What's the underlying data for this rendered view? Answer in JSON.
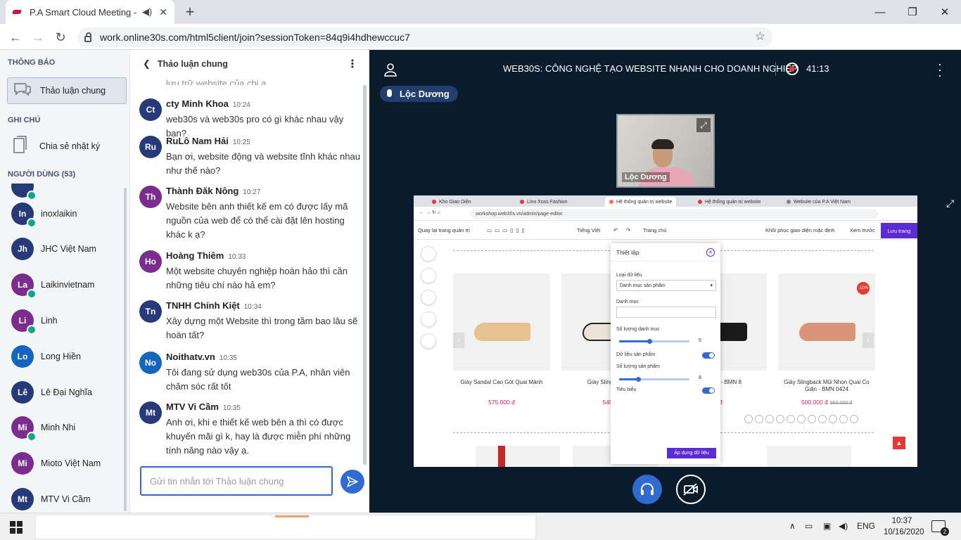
{
  "browser": {
    "tab_title": "P.A Smart Cloud Meeting - V",
    "url": "work.online30s.com/html5client/join?sessionToken=84q9i4hdhewccuc7"
  },
  "left_panel": {
    "notifications_heading": "THÔNG BÁO",
    "public_chat_label": "Thảo luận chung",
    "notes_heading": "GHI CHÚ",
    "shared_notes_label": "Chia sẻ nhật ký",
    "users_heading": "NGƯỜI DÙNG (53)",
    "users": [
      {
        "initials": "In",
        "name": "inoxlaikin"
      },
      {
        "initials": "Jh",
        "name": "JHC Việt Nam"
      },
      {
        "initials": "La",
        "name": "Laikinvietnam"
      },
      {
        "initials": "Li",
        "name": "Linh"
      },
      {
        "initials": "Lo",
        "name": "Long Hiền"
      },
      {
        "initials": "Lê",
        "name": "Lê Đại Nghĩa"
      },
      {
        "initials": "Mi",
        "name": "Minh Nhi"
      },
      {
        "initials": "Mi",
        "name": "Mioto Việt Nam"
      },
      {
        "initials": "Mt",
        "name": "MTV Vi Cầm"
      }
    ]
  },
  "chat": {
    "title": "Thảo luận chung",
    "top_fragment": "lưu trữ website của chị ạ",
    "messages": [
      {
        "initials": "Ct",
        "name": "cty Minh Khoa",
        "time": "10:24",
        "text": "web30s và web30s pro có gì khác nhau vậy bạn?"
      },
      {
        "initials": "Ru",
        "name": "RuLô Nam Hải",
        "time": "10:25",
        "text": "Bạn ơi, website động và website tĩnh khác nhau như thế nào?"
      },
      {
        "initials": "Th",
        "name": "Thành Đăk Nông",
        "time": "10:27",
        "text": "Website bên anh thiết kế em có được lấy mã nguồn của web để có thể cài đặt lên hosting khác k ạ?"
      },
      {
        "initials": "Ho",
        "name": "Hoàng Thiêm",
        "time": "10:33",
        "text": "Một website chuyên nghiệp hoàn hảo thì cần những tiêu chí nào hả em?"
      },
      {
        "initials": "Tn",
        "name": "TNHH Chính Kiệt",
        "time": "10:34",
        "text": "Xây dựng một Website thì trong tầm bao lâu sẽ hoàn tất?"
      },
      {
        "initials": "No",
        "name": "Noithatv.vn",
        "time": "10:35",
        "text": "Tôi đang sử dụng web30s của P.A, nhân viên chăm sóc rất tốt"
      },
      {
        "initials": "Mt",
        "name": "MTV Vi Cầm",
        "time": "10:35",
        "text": "Anh ơi, khi e thiết kế web bên a thì có được khuyến mãi gì k, hay là được miễn phí những tính năng nào vậy ạ."
      }
    ],
    "input_placeholder": "Gửi tin nhắn tới Thảo luận chung"
  },
  "meeting": {
    "title": "WEB30S: CÔNG NGHỆ TẠO WEBSITE NHANH CHO DOANH NGHIỆP",
    "recording_time": "41:13",
    "talker": "Lộc Dương",
    "webcam_name": "Lộc Dương"
  },
  "shared_screen": {
    "tabs": [
      "Kho Giao Diện",
      "Lino Xoss Fashion",
      "Hệ thống quản trị website",
      "Hệ thống quản trị website",
      "Website của P.A Việt Nam"
    ],
    "url": "workshop.web30s.vn/admin/page-editor",
    "toolbar": {
      "back": "Quay lại trang quản trị",
      "language": "Tiếng Việt",
      "page": "Trang chủ",
      "restore": "Khôi phục giao diện mặc định",
      "preview": "Xem trước",
      "save": "Lưu trang"
    },
    "products": [
      {
        "name": "Giày Sandal Cao Gót Quai Mảnh",
        "price": "575.000 đ",
        "old_price": ""
      },
      {
        "name": "Giày Slingback 04",
        "price": "545.0",
        "old_price": ""
      },
      {
        "name": "Mũi Nhọn - BMN 8",
        "price": "0 đ",
        "old_price": ""
      },
      {
        "name": "Giày Slingback Mũi Nhọn Quai Co Giãn - BMN 0424",
        "price": "500.000 đ",
        "old_price": "550.000 đ"
      }
    ],
    "discount_badge": "-10%",
    "settings": {
      "title": "Thiết lập",
      "data_type_label": "Loại dữ liệu",
      "data_type_value": "Danh mục sản phẩm",
      "category_label": "Danh mục",
      "category_count_label": "Số lượng danh mục",
      "category_count": "5",
      "product_data_label": "Dữ liệu sản phẩm",
      "product_count_label": "Số lượng sản phẩm",
      "product_count": "8",
      "featured_label": "Tiêu biểu",
      "apply": "Áp dụng dữ liệu"
    }
  },
  "taskbar": {
    "lang": "ENG",
    "time": "10:37",
    "date": "10/16/2020",
    "notifications": "2"
  }
}
